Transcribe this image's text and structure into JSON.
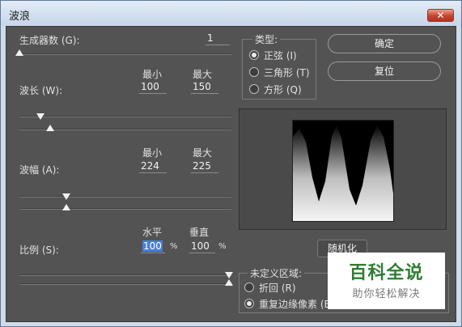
{
  "window": {
    "title": "波浪",
    "close_glyph": "✕"
  },
  "generators": {
    "label": "生成器数 (G):",
    "value": "1"
  },
  "wavelength": {
    "label": "波长 (W):",
    "min_header": "最小",
    "max_header": "最大",
    "min": "100",
    "max": "150"
  },
  "amplitude": {
    "label": "波幅 (A):",
    "min_header": "最小",
    "max_header": "最大",
    "min": "224",
    "max": "225"
  },
  "scale": {
    "label": "比例 (S):",
    "h_header": "水平",
    "v_header": "垂直",
    "h": "100",
    "v": "100",
    "unit": "%"
  },
  "type_group": {
    "title": "类型:",
    "options": [
      {
        "label": "正弦 (I)",
        "checked": true
      },
      {
        "label": "三角形 (T)",
        "checked": false
      },
      {
        "label": "方形 (Q)",
        "checked": false
      }
    ]
  },
  "buttons": {
    "ok": "确定",
    "reset": "复位",
    "randomize": "随机化"
  },
  "undefined_group": {
    "title": "未定义区域:",
    "options": [
      {
        "label": "折回 (R)",
        "checked": false
      },
      {
        "label": "重复边缘像素 (E)",
        "checked": true
      }
    ]
  },
  "watermark": {
    "title": "百科全说",
    "subtitle": "助你轻松解决"
  },
  "colors": {
    "dialog_bg": "#535353",
    "selection": "#4a7fd6",
    "watermark_green": "#2e7d32"
  }
}
